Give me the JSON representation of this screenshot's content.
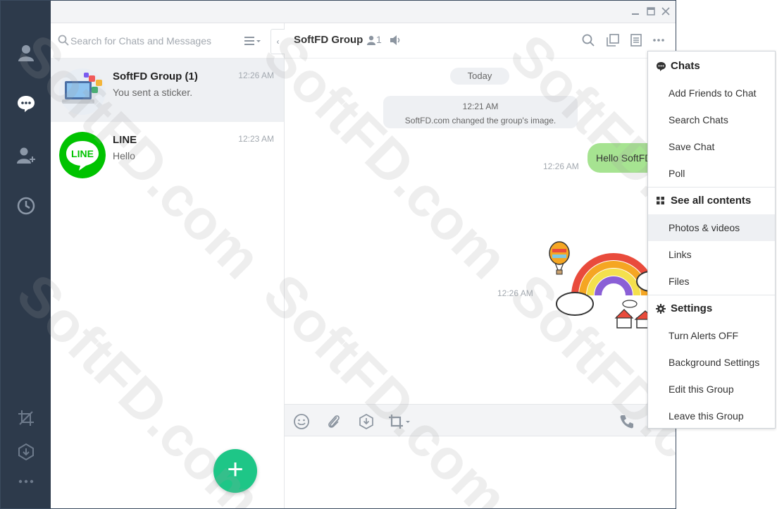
{
  "sidebar": {
    "items": [
      {
        "icon": "person-icon"
      },
      {
        "icon": "chat-bubble-icon"
      },
      {
        "icon": "add-friend-icon"
      },
      {
        "icon": "clock-icon"
      }
    ],
    "bottom": [
      {
        "icon": "crop-icon"
      },
      {
        "icon": "download-icon"
      },
      {
        "icon": "more-icon"
      }
    ]
  },
  "chatlist": {
    "search_placeholder": "Search for Chats and Messages",
    "chats": [
      {
        "name": "SoftFD Group (1)",
        "preview": "You sent a sticker.",
        "time": "12:26 AM"
      },
      {
        "name": "LINE",
        "preview": "Hello",
        "time": "12:23 AM",
        "logo_text": "LINE"
      }
    ],
    "fab_label": "+"
  },
  "chat": {
    "title": "SoftFD Group",
    "member_count": "1",
    "date_label": "Today",
    "system_time": "12:21 AM",
    "system_text": "SoftFD.com changed the group's image.",
    "my_message": "Hello SoftFD",
    "my_message_time": "12:26 AM",
    "sticker_time": "12:26 AM"
  },
  "menu": {
    "chats_heading": "Chats",
    "chats_items": [
      "Add Friends to Chat",
      "Search Chats",
      "Save Chat",
      "Poll"
    ],
    "contents_heading": "See all contents",
    "contents_items": [
      "Photos & videos",
      "Links",
      "Files"
    ],
    "settings_heading": "Settings",
    "settings_items": [
      "Turn Alerts OFF",
      "Background Settings",
      "Edit this Group",
      "Leave this Group"
    ]
  },
  "watermark": "SoftFD.com",
  "colors": {
    "sidebar_bg": "#2d3a4b",
    "accent_green": "#1ec687",
    "bubble_green": "#a6e391",
    "line_green": "#00c300"
  }
}
